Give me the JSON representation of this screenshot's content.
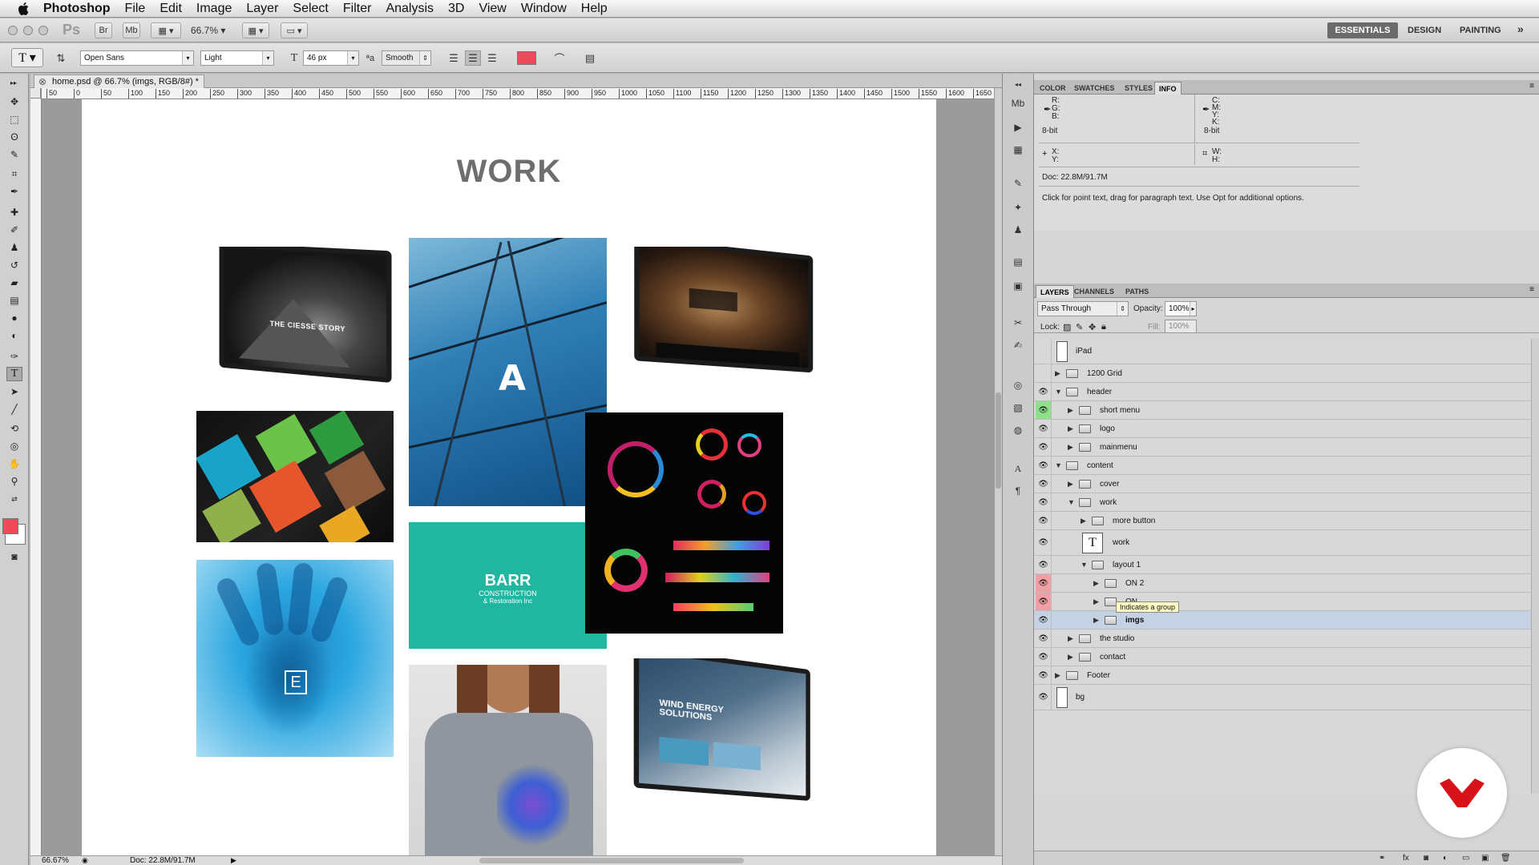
{
  "menubar": {
    "app_name": "Photoshop",
    "items": [
      "File",
      "Edit",
      "Image",
      "Layer",
      "Select",
      "Filter",
      "Analysis",
      "3D",
      "View",
      "Window",
      "Help"
    ]
  },
  "appbar": {
    "ps_logo": "Ps",
    "bridge": "Br",
    "minibridge": "Mb",
    "zoom": "66.7%",
    "workspaces": [
      "ESSENTIALS",
      "DESIGN",
      "PAINTING"
    ],
    "more": "»"
  },
  "options": {
    "font_family": "Open Sans",
    "font_style": "Light",
    "font_size": "46 px",
    "aa_label": "ªa",
    "antialias": "Smooth",
    "text_color": "#ee4b5a"
  },
  "document": {
    "tab_title": "home.psd @ 66.7% (imgs, RGB/8#) *",
    "ruler_marks": [
      "50",
      "0",
      "50",
      "100",
      "150",
      "200",
      "250",
      "300",
      "350",
      "400",
      "450",
      "500",
      "550",
      "600",
      "650",
      "700",
      "750",
      "800",
      "850",
      "900",
      "950",
      "1000",
      "1050",
      "1100",
      "1150",
      "1200",
      "1250",
      "1300",
      "1350",
      "1400",
      "1450",
      "1500",
      "1550",
      "1600",
      "1650"
    ],
    "zoom_status": "66.67%",
    "doc_status": "Doc: 22.8M/91.7M"
  },
  "canvas": {
    "heading": "WORK",
    "tile_texts": {
      "mountain": "THE CIESSE STORY",
      "barr_title": "BARR",
      "barr_sub1": "CONSTRUCTION",
      "barr_sub2": "& Restoration Inc",
      "hand_letter": "E",
      "wind_title": "WIND ENERGY SOLUTIONS",
      "arch_letter": "A"
    }
  },
  "info_panel": {
    "tabs": [
      "COLOR",
      "SWATCHES",
      "STYLES",
      "INFO"
    ],
    "active_tab": "INFO",
    "rgb_labels": [
      "R:",
      "G:",
      "B:"
    ],
    "cmyk_labels": [
      "C:",
      "M:",
      "Y:",
      "K:"
    ],
    "bit_left": "8-bit",
    "bit_right": "8-bit",
    "xy_labels": [
      "X:",
      "Y:"
    ],
    "wh_labels": [
      "W:",
      "H:"
    ],
    "doc": "Doc: 22.8M/91.7M",
    "hint": "Click for point text, drag for paragraph text. Use Opt for additional options."
  },
  "layers_panel": {
    "tabs": [
      "LAYERS",
      "CHANNELS",
      "PATHS"
    ],
    "active_tab": "LAYERS",
    "blend_mode": "Pass Through",
    "opacity_label": "Opacity:",
    "opacity": "100%",
    "lock_label": "Lock:",
    "fill_label": "Fill:",
    "fill": "100%",
    "tooltip": "Indicates a group",
    "layers": [
      {
        "name": "iPad",
        "kind": "thumb",
        "indent": 0,
        "eye": "none",
        "arrow": ""
      },
      {
        "name": "1200 Grid",
        "kind": "folder",
        "indent": 0,
        "eye": "none",
        "arrow": "▶"
      },
      {
        "name": "header",
        "kind": "folder",
        "indent": 0,
        "eye": "eye",
        "arrow": "▼"
      },
      {
        "name": "short menu",
        "kind": "folder",
        "indent": 1,
        "eye": "green",
        "arrow": "▶"
      },
      {
        "name": "logo",
        "kind": "folder",
        "indent": 1,
        "eye": "eye",
        "arrow": "▶"
      },
      {
        "name": "mainmenu",
        "kind": "folder",
        "indent": 1,
        "eye": "eye",
        "arrow": "▶"
      },
      {
        "name": "content",
        "kind": "folder",
        "indent": 0,
        "eye": "eye",
        "arrow": "▼"
      },
      {
        "name": "cover",
        "kind": "folder",
        "indent": 1,
        "eye": "eye",
        "arrow": "▶"
      },
      {
        "name": "work",
        "kind": "folder",
        "indent": 1,
        "eye": "eye",
        "arrow": "▼"
      },
      {
        "name": "more button",
        "kind": "folder",
        "indent": 2,
        "eye": "eye",
        "arrow": "▶"
      },
      {
        "name": "work",
        "kind": "text",
        "indent": 2,
        "eye": "eye",
        "arrow": ""
      },
      {
        "name": "layout 1",
        "kind": "folder",
        "indent": 2,
        "eye": "eye",
        "arrow": "▼"
      },
      {
        "name": "ON 2",
        "kind": "folder",
        "indent": 3,
        "eye": "red",
        "arrow": "▶"
      },
      {
        "name": "ON",
        "kind": "folder",
        "indent": 3,
        "eye": "red",
        "arrow": "▶"
      },
      {
        "name": "imgs",
        "kind": "folder",
        "indent": 3,
        "eye": "eye",
        "arrow": "▶",
        "selected": true
      },
      {
        "name": "the studio",
        "kind": "folder",
        "indent": 1,
        "eye": "eye",
        "arrow": "▶"
      },
      {
        "name": "contact",
        "kind": "folder",
        "indent": 1,
        "eye": "eye",
        "arrow": "▶"
      },
      {
        "name": "Footer",
        "kind": "folder",
        "indent": 0,
        "eye": "eye",
        "arrow": "▶"
      },
      {
        "name": "bg",
        "kind": "thumb",
        "indent": 0,
        "eye": "eye",
        "arrow": ""
      }
    ]
  },
  "icons": {
    "eye": "eye-icon",
    "folder": "folder-icon",
    "text_layer": "text-layer-icon",
    "brand_badge": "red-chevron-logo"
  },
  "colors": {
    "accent_red": "#ee4b5a",
    "teal": "#21b6a0",
    "selected_row": "#c5d2e4"
  }
}
